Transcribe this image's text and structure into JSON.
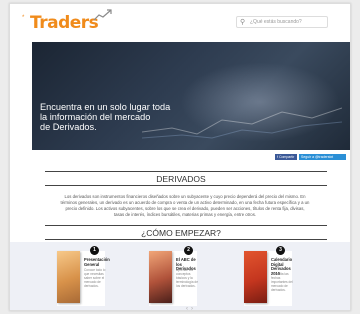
{
  "header": {
    "logo_text": "Traders",
    "logo_star": "*",
    "search_placeholder": "¿Qué estás buscando?"
  },
  "hero": {
    "line1": "Encuentra en un solo lugar toda",
    "line2": "la información del mercado",
    "line3": "de Derivados."
  },
  "social": {
    "facebook_label": "f Compartir",
    "twitter_label": "Seguir a @traderstxt"
  },
  "derivados": {
    "title": "DERIVADOS",
    "description": "Los derivados son instrumentos financieros diseñados sobre un subyacente y cuyo precio dependerá del precio del mismo. En términos generales, un derivado es un acuerdo de compra o venta de un activo determinado, en una fecha futura específica y a un precio definido. Los activos subyacentes, sobre los que se crea el derivado, pueden ser acciones, títulos de renta fija, divisas, tasas de interés, índices bursátiles, materias primas y energía, entre otros."
  },
  "start": {
    "title": "¿CÓMO EMPEZAR?",
    "cards": [
      {
        "number": "1",
        "title": "Presentación General",
        "text": "Conoce todo lo que necesitas saber sobre el mercado de derivados."
      },
      {
        "number": "2",
        "title": "El ABC de los Derivados",
        "text": "Aprende los conceptos básicos y la terminología de los derivados."
      },
      {
        "number": "3",
        "title": "Calendario Digital Derivados 2015",
        "text": "Consulta las fechas importantes del mercado de derivados."
      }
    ],
    "prev_arrow": "‹",
    "next_arrow": "›"
  },
  "colors": {
    "brand": "#f08b1b",
    "hero_dark": "#1b2533",
    "card_band": "#eef0f6",
    "card3": "#c4361f"
  }
}
